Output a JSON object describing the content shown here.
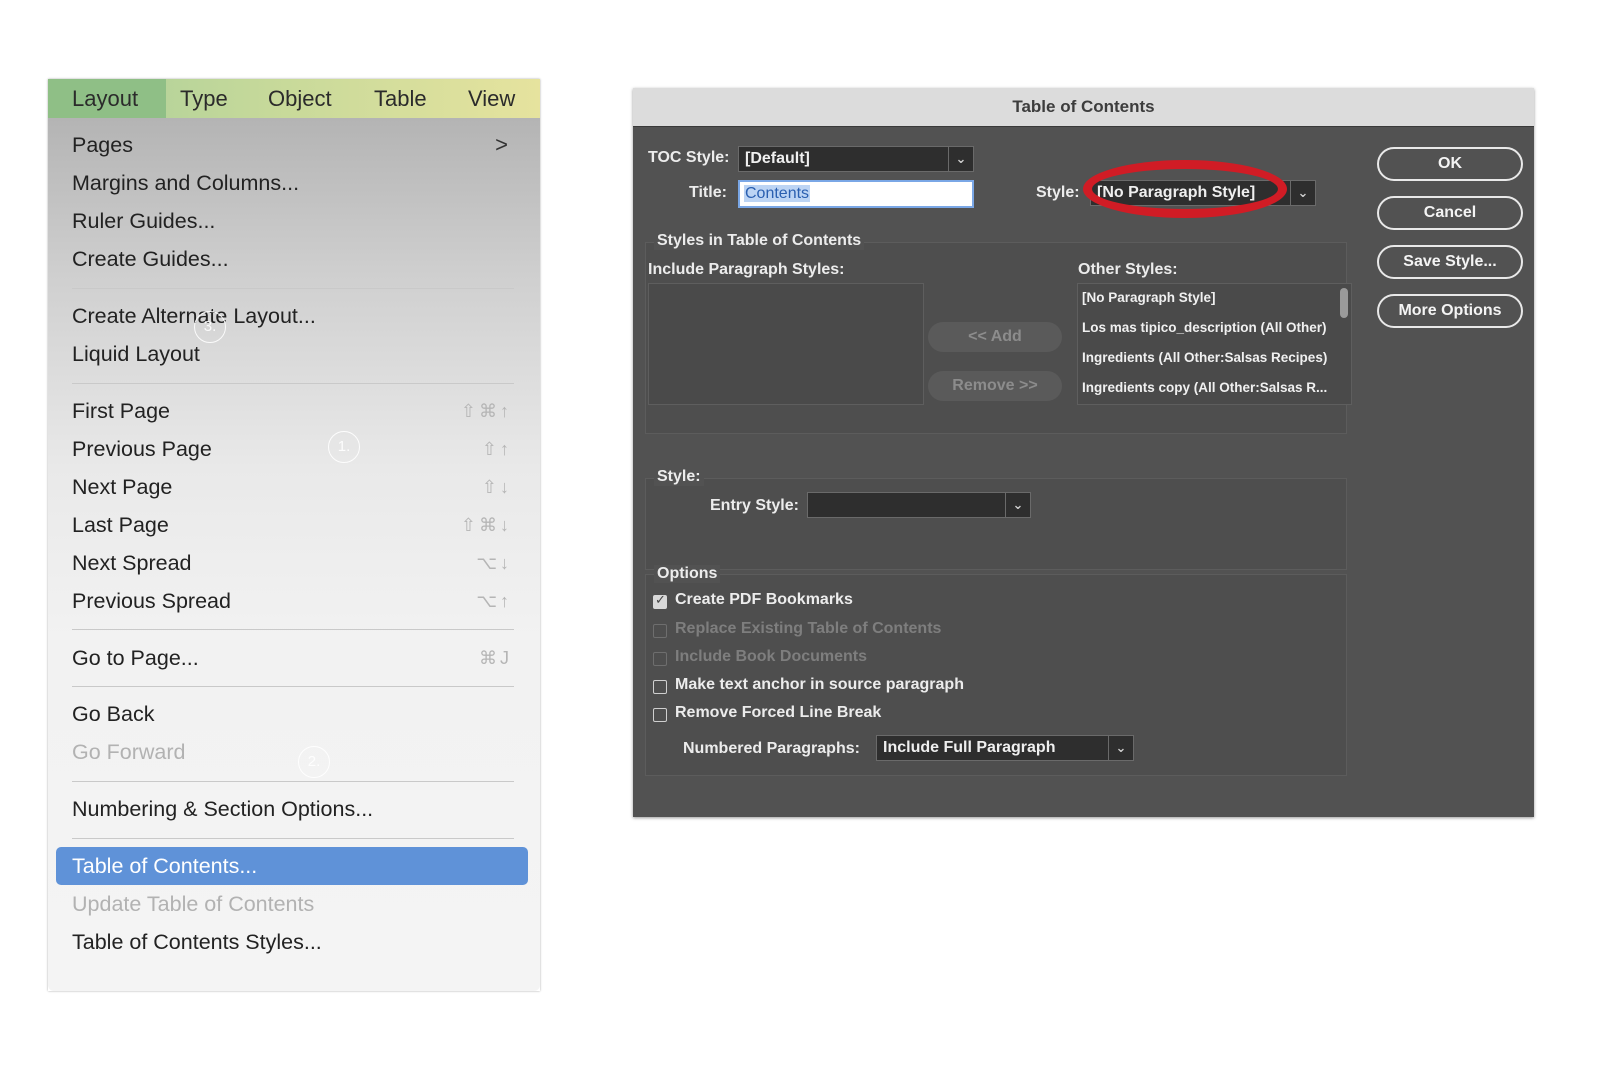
{
  "menubar": {
    "items": [
      "Layout",
      "Type",
      "Object",
      "Table",
      "View"
    ],
    "active": "Layout"
  },
  "menu": {
    "items": [
      {
        "label": "Pages",
        "shortcut": ""
      },
      {
        "label": "Margins and Columns...",
        "shortcut": ""
      },
      {
        "label": "Ruler Guides...",
        "shortcut": ""
      },
      {
        "label": "Create Guides...",
        "shortcut": ""
      },
      {
        "label": "Create Alternate Layout...",
        "shortcut": ""
      },
      {
        "label": "Liquid Layout",
        "shortcut": ""
      },
      {
        "label": "First Page",
        "shortcut": "⇧⌘↑"
      },
      {
        "label": "Previous Page",
        "shortcut": "⇧↑"
      },
      {
        "label": "Next Page",
        "shortcut": "⇧↓"
      },
      {
        "label": "Last Page",
        "shortcut": "⇧⌘↓"
      },
      {
        "label": "Next Spread",
        "shortcut": "⌥↓"
      },
      {
        "label": "Previous Spread",
        "shortcut": "⌥↑"
      },
      {
        "label": "Go to Page...",
        "shortcut": "⌘J"
      },
      {
        "label": "Go Back",
        "shortcut": ""
      },
      {
        "label": "Go Forward",
        "shortcut": ""
      },
      {
        "label": "Numbering & Section Options...",
        "shortcut": ""
      },
      {
        "label": "Table of Contents...",
        "shortcut": ""
      },
      {
        "label": "Update Table of Contents",
        "shortcut": ""
      },
      {
        "label": "Table of Contents Styles...",
        "shortcut": ""
      }
    ],
    "submenu_arrow": ">",
    "markers": [
      "3.",
      "1.",
      "2."
    ]
  },
  "dialog": {
    "title": "Table of Contents",
    "toc_style_label": "TOC Style:",
    "toc_style_value": "[Default]",
    "title_label": "Title:",
    "title_value": "Contents",
    "style_label": "Style:",
    "style_value": "[No Paragraph Style]",
    "styles_section": "Styles in Table of Contents",
    "include_label": "Include Paragraph Styles:",
    "other_label": "Other Styles:",
    "other_styles": [
      "[No Paragraph Style]",
      "Los mas tipico_description (All Other)",
      "Ingredients (All Other:Salsas Recipes)",
      "Ingredients copy (All Other:Salsas R..."
    ],
    "add_button": "<< Add",
    "remove_button": "Remove >>",
    "style_section": "Style:",
    "entry_style_label": "Entry Style:",
    "entry_style_value": "",
    "options_label": "Options",
    "checkboxes": [
      {
        "label": "Create PDF Bookmarks",
        "checked": true,
        "enabled": true
      },
      {
        "label": "Replace Existing Table of Contents",
        "checked": false,
        "enabled": false
      },
      {
        "label": "Include Book Documents",
        "checked": false,
        "enabled": false
      },
      {
        "label": "Make text anchor in source paragraph",
        "checked": false,
        "enabled": true
      },
      {
        "label": "Remove Forced Line Break",
        "checked": false,
        "enabled": true
      }
    ],
    "numbered_label": "Numbered Paragraphs:",
    "numbered_value": "Include Full Paragraph",
    "buttons": {
      "ok": "OK",
      "cancel": "Cancel",
      "save": "Save Style...",
      "more": "More Options"
    },
    "highlight_color": "#d01c25"
  }
}
